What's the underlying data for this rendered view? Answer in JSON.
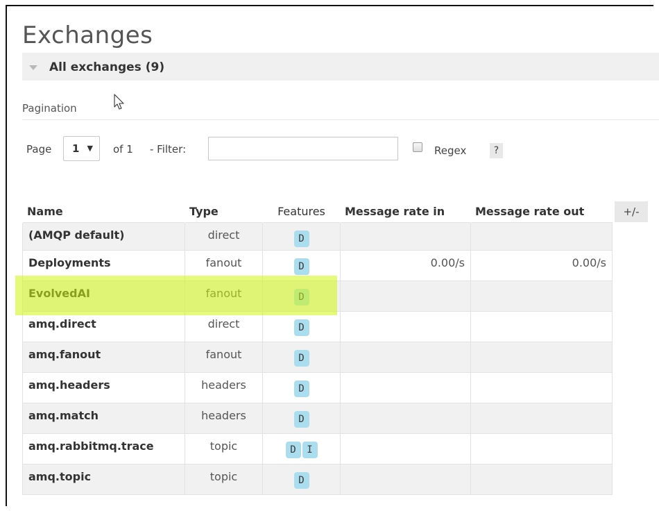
{
  "page": {
    "title": "Exchanges"
  },
  "section": {
    "label": "All exchanges (9)"
  },
  "pagination": {
    "label": "Pagination",
    "page_word": "Page",
    "current_page": "1",
    "of_text": "of 1",
    "filter_label": "- Filter:",
    "filter_value": "",
    "regex_label": "Regex",
    "regex_checked": false,
    "help_label": "?"
  },
  "table": {
    "columns": [
      "Name",
      "Type",
      "Features",
      "Message rate in",
      "Message rate out"
    ],
    "column_toggle": "+/-",
    "rows": [
      {
        "name": "(AMQP default)",
        "type": "direct",
        "features": [
          "D"
        ],
        "rate_in": "",
        "rate_out": ""
      },
      {
        "name": "Deployments",
        "type": "fanout",
        "features": [
          "D"
        ],
        "rate_in": "0.00/s",
        "rate_out": "0.00/s"
      },
      {
        "name": "EvolvedAI",
        "type": "fanout",
        "features": [
          "D"
        ],
        "rate_in": "",
        "rate_out": "",
        "highlighted": true
      },
      {
        "name": "amq.direct",
        "type": "direct",
        "features": [
          "D"
        ],
        "rate_in": "",
        "rate_out": ""
      },
      {
        "name": "amq.fanout",
        "type": "fanout",
        "features": [
          "D"
        ],
        "rate_in": "",
        "rate_out": ""
      },
      {
        "name": "amq.headers",
        "type": "headers",
        "features": [
          "D"
        ],
        "rate_in": "",
        "rate_out": ""
      },
      {
        "name": "amq.match",
        "type": "headers",
        "features": [
          "D"
        ],
        "rate_in": "",
        "rate_out": ""
      },
      {
        "name": "amq.rabbitmq.trace",
        "type": "topic",
        "features": [
          "D",
          "I"
        ],
        "rate_in": "",
        "rate_out": ""
      },
      {
        "name": "amq.topic",
        "type": "topic",
        "features": [
          "D"
        ],
        "rate_in": "",
        "rate_out": ""
      }
    ]
  },
  "colors": {
    "badge": "#aaddee",
    "highlight": "#d0f50f",
    "row_alt": "#f1f1f1"
  },
  "icons": {
    "section_toggle": "triangle-down-icon",
    "pointer": "mouse-cursor-icon"
  }
}
